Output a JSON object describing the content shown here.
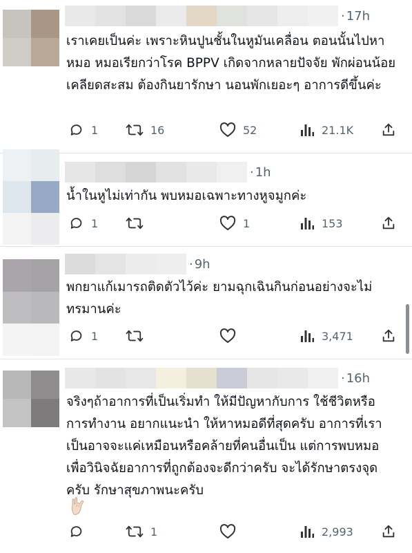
{
  "replies": [
    {
      "time": "17h",
      "text": "เราเคยเป็นค่ะ เพราะหินปูนชั้นในหูมันเคลื่อน ตอนนั้นไปหาหมอ หมอเรียกว่าโรค BPPV เกิดจากหลายปัจจัย พักผ่อนน้อย เคลียดสะสม ต้องกินยารักษา นอนพักเยอะๆ อาการดีขึ้นค่ะ",
      "replies": "1",
      "reposts": "16",
      "likes": "52",
      "views": "21.1K",
      "avatar_colors": [
        "#c7c3bd",
        "#aa9685",
        "#cfcbc5",
        "#b9a797"
      ],
      "name_colors": [
        "#e9e9ea",
        "#e3e3e4",
        "#dadadb",
        "#ebebeb",
        "#e3d8c5",
        "#dfe2dd",
        "#e6e6e6",
        "#eeeeee",
        "#f1f1f1"
      ]
    },
    {
      "time": "1h",
      "text": "น้ำในหูไม่เท่ากัน พบหมอเฉพาะทางหูจมูกค่ะ",
      "replies": "1",
      "reposts": "",
      "likes": "1",
      "views": "153",
      "avatar_colors": [
        "#eef1f3",
        "#e7ecef",
        "#dde6ec",
        "#98a9c8",
        "#f3f3f4",
        "#ececee"
      ],
      "name_colors": [
        "#e6e6e7",
        "#dededf",
        "#d6d6d7",
        "#e2e2e3",
        "#e9e9ea",
        "#f0f0f0"
      ]
    },
    {
      "time": "9h",
      "text": "พกยาแก้เมารถติดตัวไว้ค่ะ ยามฉุกเฉินกินก่อนอย่างจะไม่ทรมานค่ะ",
      "replies": "1",
      "reposts": "",
      "likes": "",
      "views": "3,471",
      "avatar_colors": [
        "#aaa5aa",
        "#a6a3a7",
        "#bdbcbe",
        "#b9b8ba",
        "#f4f4f4",
        "#f3f3f3"
      ],
      "name_colors": [
        "#dcdcdc",
        "#e4e4e4",
        "#ececec",
        "#eeeeee"
      ]
    },
    {
      "time": "16h",
      "text": "จริงๆถ้าอาการที่เป็นเริ่มทำ ให้มีปัญหากับการ ใช้ชีวิตหรือการทำงาน อยากแนะนำ ให้หาหมอดีที่สุดครับ อาการที่เราเป็นอาจจะแค่เหมือนหรือคล้ายที่คนอื่นเป็น แต่การพบหมอเพื่อวินิจฉัยอาการที่ถูกต้องจะดีกว่าครับ จะได้รักษาตรงจุดครับ รักษาสุขภาพนะครับ",
      "replies": "",
      "reposts": "1",
      "likes": "",
      "views": "2,993",
      "avatar_colors": [
        "#b8b7b8",
        "#8e8c8c",
        "#c4c3c4",
        "#7d7b7b"
      ],
      "name_colors": [
        "#e8e8e8",
        "#e3e3e3",
        "#e7e7e7",
        "#f5efdf",
        "#e5e0cf",
        "#c9ccd6",
        "#e6e6e6",
        "#e9e9e9",
        "#f0f0f0"
      ]
    }
  ]
}
